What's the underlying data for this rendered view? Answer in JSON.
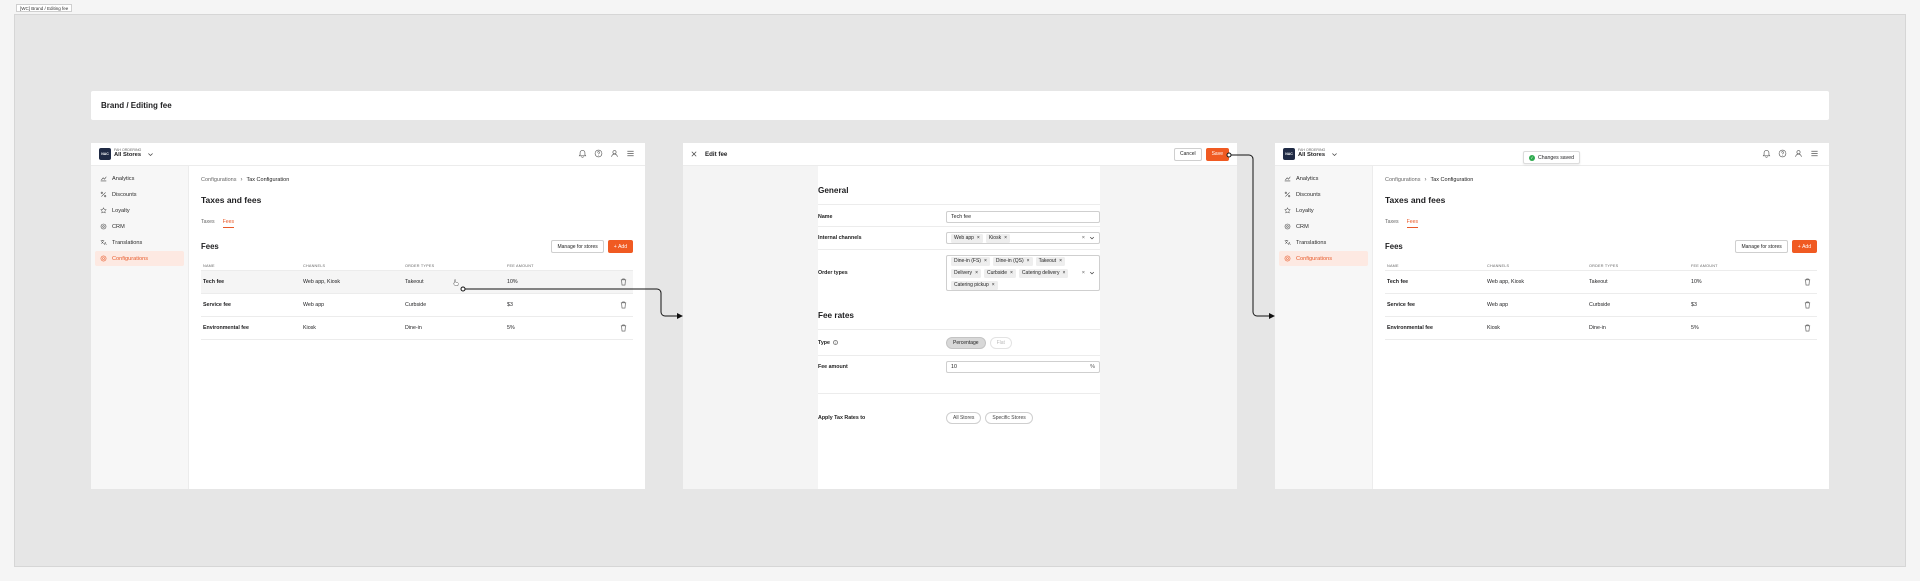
{
  "frame_label": "[WC] Brand / Editing fee",
  "banner_title": "Brand / Editing fee",
  "app": {
    "logo": "NAC",
    "subtitle": "FAH ORDERING",
    "store_select": "All Stores"
  },
  "nav": [
    {
      "label": "Analytics",
      "icon": "analytics-icon"
    },
    {
      "label": "Discounts",
      "icon": "percent-icon"
    },
    {
      "label": "Loyalty",
      "icon": "star-icon"
    },
    {
      "label": "CRM",
      "icon": "crm-icon"
    },
    {
      "label": "Translations",
      "icon": "translate-icon"
    },
    {
      "label": "Configurations",
      "icon": "gear-icon",
      "active": true
    }
  ],
  "breadcrumb": {
    "parent": "Configurations",
    "current": "Tax Configuration"
  },
  "page_title": "Taxes and fees",
  "tabs": {
    "taxes": "Taxes",
    "fees": "Fees"
  },
  "fees": {
    "title": "Fees",
    "manage_button": "Manage for stores",
    "add_button": "Add",
    "columns": [
      "NAME",
      "CHANNELS",
      "ORDER TYPES",
      "FEE AMOUNT"
    ],
    "rows": [
      {
        "name": "Tech fee",
        "channels": "Web app, Kiosk",
        "order_types": "Takeout",
        "amount": "10%"
      },
      {
        "name": "Service fee",
        "channels": "Web app",
        "order_types": "Curbside",
        "amount": "$3"
      },
      {
        "name": "Environmental fee",
        "channels": "Kiosk",
        "order_types": "Dine-in",
        "amount": "5%"
      }
    ]
  },
  "edit": {
    "title": "Edit fee",
    "cancel": "Cancel",
    "save": "Save",
    "general": "General",
    "name_label": "Name",
    "name_value": "Tech fee",
    "channels_label": "Internal channels",
    "channels": [
      "Web app",
      "Kiosk"
    ],
    "order_types_label": "Order types",
    "order_types": [
      "Dine-in (FS)",
      "Dine-in (QS)",
      "Takeout",
      "Delivery",
      "Curbside",
      "Catering delivery",
      "Catering pickup"
    ],
    "rates": "Fee rates",
    "type_label": "Type",
    "type_options": [
      "Percentage",
      "Flat"
    ],
    "amount_label": "Fee amount",
    "amount_value": "10",
    "amount_unit": "%",
    "apply_label": "Apply Tax Rates to",
    "apply_options": [
      "All Stores",
      "Specific Stores"
    ]
  },
  "toast": "Changes saved",
  "colors": {
    "accent": "#f05a22",
    "canvas": "#e6e6e6",
    "success": "#2eaa4e"
  }
}
